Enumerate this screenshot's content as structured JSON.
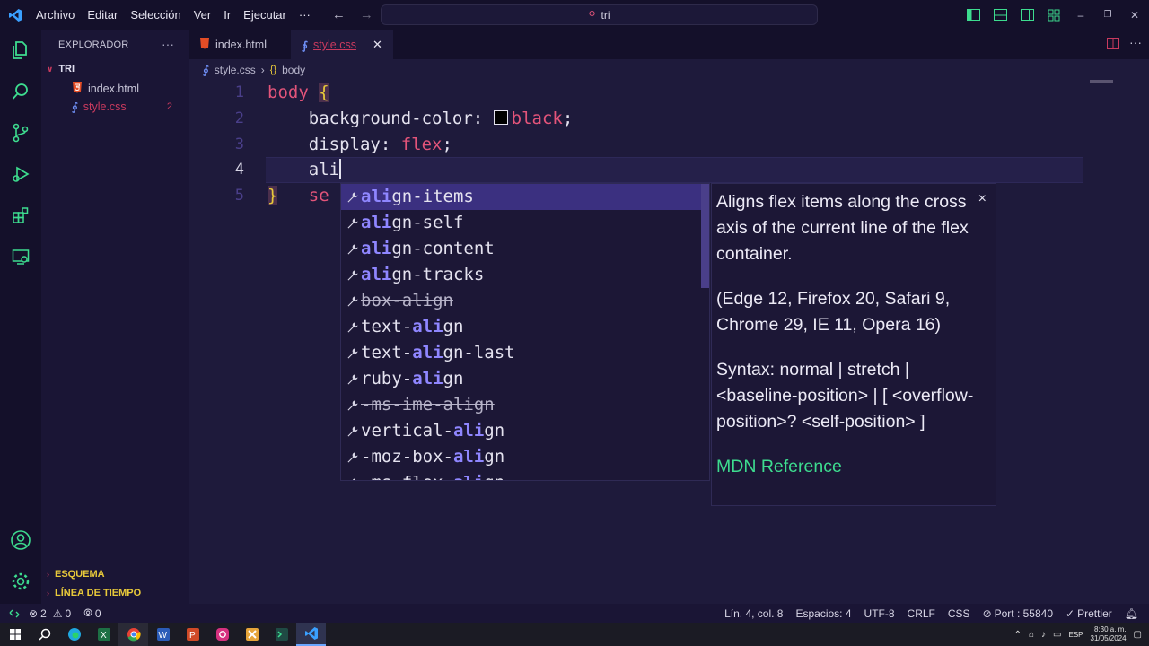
{
  "titlebar": {
    "menu": [
      "Archivo",
      "Editar",
      "Selección",
      "Ver",
      "Ir",
      "Ejecutar",
      "···"
    ],
    "search_text": "tri"
  },
  "sidebar": {
    "title": "EXPLORADOR",
    "more": "···",
    "root": "TRI",
    "files": [
      {
        "name": "index.html",
        "badge": ""
      },
      {
        "name": "style.css",
        "badge": "2"
      }
    ],
    "sections": [
      "ESQUEMA",
      "LÍNEA DE TIEMPO"
    ]
  },
  "tabs": [
    {
      "label": "index.html",
      "active": false
    },
    {
      "label": "style.css",
      "active": true
    }
  ],
  "breadcrumb": {
    "file": "style.css",
    "symbol": "body"
  },
  "editor": {
    "line_numbers": [
      "1",
      "2",
      "3",
      "4",
      "5"
    ],
    "line1_selector": "body",
    "line1_brace": "{",
    "line2_prop": "background-color: ",
    "line2_value": "black",
    "line2_end": ";",
    "line3_prop": "display: ",
    "line3_value": "flex",
    "line3_end": ";",
    "line4_text": "ali",
    "line5_brace": "}",
    "line5_partial": "se"
  },
  "suggest": {
    "items": [
      {
        "pre": "",
        "match": "ali",
        "post": "gn-items",
        "deprecated": false,
        "selected": true
      },
      {
        "pre": "",
        "match": "ali",
        "post": "gn-self",
        "deprecated": false
      },
      {
        "pre": "",
        "match": "ali",
        "post": "gn-content",
        "deprecated": false
      },
      {
        "pre": "",
        "match": "ali",
        "post": "gn-tracks",
        "deprecated": false
      },
      {
        "pre": "box-align",
        "match": "",
        "post": "",
        "deprecated": true
      },
      {
        "pre": "text-",
        "match": "ali",
        "post": "gn",
        "deprecated": false
      },
      {
        "pre": "text-",
        "match": "ali",
        "post": "gn-last",
        "deprecated": false
      },
      {
        "pre": "ruby-",
        "match": "ali",
        "post": "gn",
        "deprecated": false
      },
      {
        "pre": "-ms-ime-align",
        "match": "",
        "post": "",
        "deprecated": true
      },
      {
        "pre": "vertical-",
        "match": "ali",
        "post": "gn",
        "deprecated": false
      },
      {
        "pre": "-moz-box-",
        "match": "ali",
        "post": "gn",
        "deprecated": false
      },
      {
        "pre": "-ms-flex-",
        "match": "ali",
        "post": "gn",
        "deprecated": false
      }
    ]
  },
  "details": {
    "description": "Aligns flex items along the cross axis of the current line of the flex container.",
    "compat": "(Edge 12, Firefox 20, Safari 9, Chrome 29, IE 11, Opera 16)",
    "syntax": "Syntax: normal | stretch | <baseline-position> | [ <overflow-position>? <self-position> ]",
    "reference": "MDN Reference",
    "close": "×"
  },
  "statusbar": {
    "errors": "2",
    "warnings": "0",
    "ports_count": "0",
    "position": "Lín. 4, col. 8",
    "spaces": "Espacios: 4",
    "encoding": "UTF-8",
    "eol": "CRLF",
    "language": "CSS",
    "port": "Port : 55840",
    "formatter": "Prettier"
  },
  "taskbar": {
    "lang": "ESP",
    "time": "8:30 a. m.",
    "date": "31/05/2024"
  },
  "colors": {
    "background": "#1e1a3b",
    "sidebar": "#1a1535",
    "keyword": "#e3547a",
    "match": "#8f86ff",
    "selection": "#3b3080",
    "link": "#3ddc8f",
    "accent": "#e8c93a"
  }
}
